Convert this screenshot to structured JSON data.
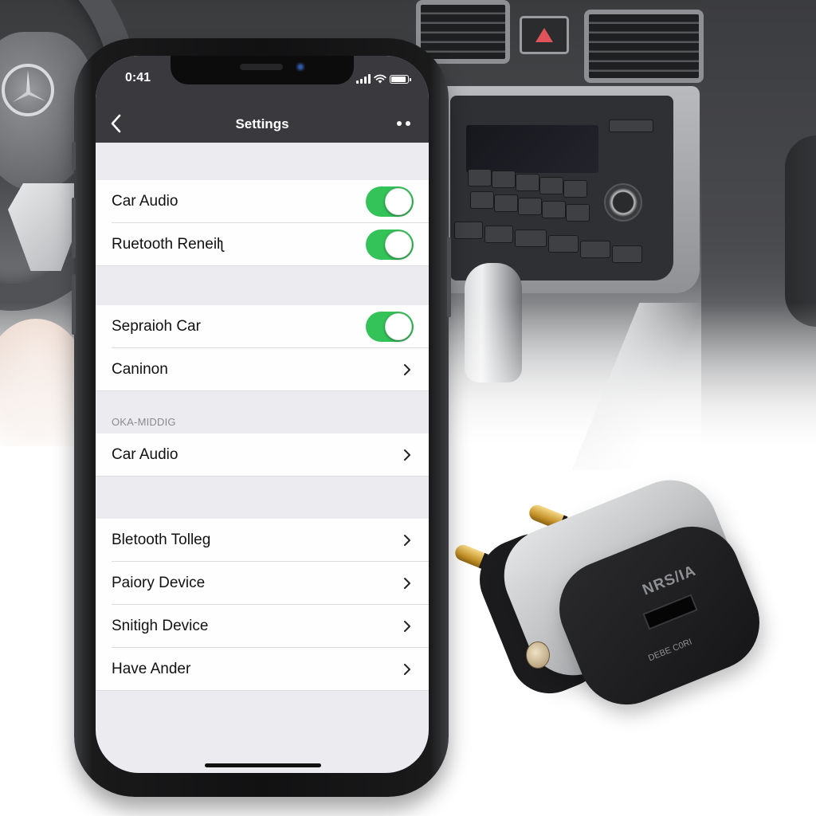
{
  "status_bar": {
    "time": "0:41",
    "signal_icon": "cellular-signal-icon",
    "wifi_icon": "wifi-icon",
    "battery_icon": "battery-icon"
  },
  "nav_bar": {
    "back_icon": "chevron-left-icon",
    "title": "Settings",
    "more_icon": "more-dots-icon"
  },
  "groups": [
    {
      "header": "",
      "rows": [
        {
          "label": "Car Audio",
          "control": "toggle",
          "on": true
        },
        {
          "label": "Ruetooth Reneilʅ",
          "control": "toggle",
          "on": true
        }
      ]
    },
    {
      "header": "",
      "rows": [
        {
          "label": "Sepraioh Car",
          "control": "toggle",
          "on": true
        },
        {
          "label": "Caninon",
          "control": "chevron"
        }
      ]
    },
    {
      "header": "OKA-MIDDIG",
      "rows": [
        {
          "label": "Car Audio",
          "control": "chevron"
        }
      ]
    },
    {
      "header": "",
      "rows": [
        {
          "label": "Bletooth Tolleg",
          "control": "chevron"
        },
        {
          "label": "Paiory Device",
          "control": "chevron"
        },
        {
          "label": "Snitigh Device",
          "control": "chevron"
        },
        {
          "label": "Have Ander",
          "control": "chevron"
        }
      ]
    }
  ],
  "colors": {
    "toggle_on": "#33c359",
    "nav_bar_bg": "#3a393e",
    "grouped_bg": "#ebebf0",
    "cell_bg": "#fefefe"
  },
  "product": {
    "brand_text": "NRS/IA",
    "sub_text": "DEBE C0RI"
  }
}
